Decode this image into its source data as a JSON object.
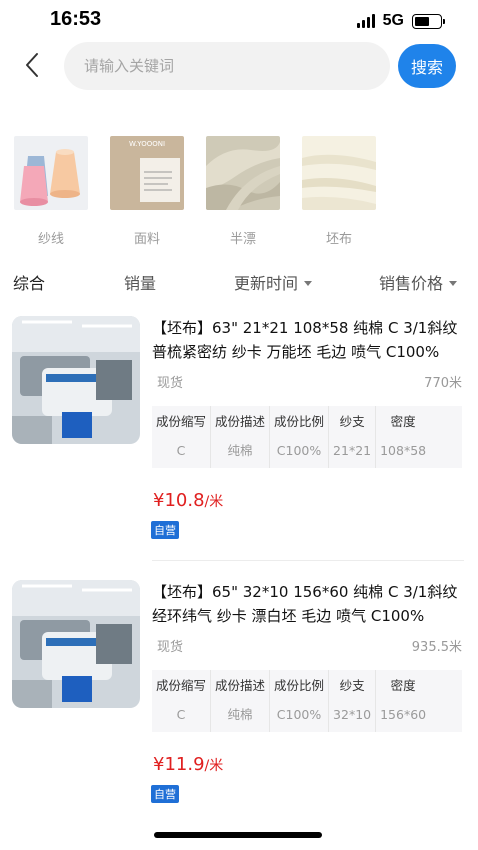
{
  "status": {
    "time": "16:53",
    "network": "5G"
  },
  "search": {
    "placeholder": "请输入关键词",
    "button_label": "搜索"
  },
  "categories": [
    {
      "label": "纱线",
      "icon": "yarn-cones-image"
    },
    {
      "label": "面料",
      "icon": "fabric-label-image",
      "thumb_text": "W.YOOONI"
    },
    {
      "label": "半漂",
      "icon": "half-bleached-cloth-image"
    },
    {
      "label": "坯布",
      "icon": "grey-cloth-image"
    }
  ],
  "sort": {
    "comprehensive": "综合",
    "sales": "销量",
    "updated": "更新时间",
    "price": "销售价格"
  },
  "spec_headers": [
    "成份缩写",
    "成份描述",
    "成份比例",
    "纱支",
    "密度"
  ],
  "products": [
    {
      "title": "【坯布】63\" 21*21 108*58 纯棉 C 3/1斜纹 普梳紧密纺 纱卡 万能坯 毛边 喷气 C100%",
      "stock": "现货",
      "quantity": "770米",
      "specs": [
        "C",
        "纯棉",
        "C100%",
        "21*21",
        "108*58"
      ],
      "price": "¥10.8",
      "unit": "/米",
      "badge": "自营"
    },
    {
      "title": "【坯布】65\" 32*10 156*60 纯棉 C 3/1斜纹 经环纬气 纱卡 漂白坯 毛边 喷气 C100%",
      "stock": "现货",
      "quantity": "935.5米",
      "specs": [
        "C",
        "纯棉",
        "C100%",
        "32*10",
        "156*60"
      ],
      "price": "¥11.9",
      "unit": "/米",
      "badge": "自营"
    }
  ],
  "colors": {
    "accent": "#1f83ea",
    "price": "#e02020",
    "badge": "#1f6fd6"
  }
}
